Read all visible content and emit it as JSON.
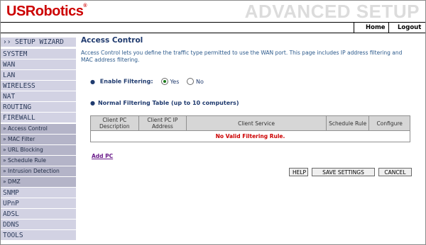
{
  "brand": {
    "logo": "USRobotics",
    "logo_mark": "®",
    "banner": "ADVANCED SETUP"
  },
  "topnav": {
    "home": "Home",
    "logout": "Logout"
  },
  "sidebar": {
    "wizard": "›› SETUP WIZARD",
    "main_items": [
      "SYSTEM",
      "WAN",
      "LAN",
      "WIRELESS",
      "NAT",
      "ROUTING",
      "FIREWALL"
    ],
    "sub_items": [
      "» Access Control",
      "» MAC Filter",
      "» URL Blocking",
      "» Schedule Rule",
      "» Intrusion Detection",
      "» DMZ"
    ],
    "more_items": [
      "SNMP",
      "UPnP",
      "ADSL",
      "DDNS",
      "TOOLS"
    ]
  },
  "page": {
    "title": "Access Control",
    "description": "Access Control lets you define the traffic type permitted to use the WAN port. This page includes IP address filtering and MAC address filtering.",
    "enable_filtering_label": "Enable Filtering:",
    "radio_yes": "Yes",
    "radio_no": "No",
    "table_title": "Normal Filtering Table (up to 10 computers)",
    "table_headers": [
      "Client PC Description",
      "Client PC IP Address",
      "Client Service",
      "Schedule Rule",
      "Configure"
    ],
    "empty_message": "No Valid Filtering Rule.",
    "add_pc": "Add PC",
    "buttons": {
      "help": "HELP",
      "save": "SAVE SETTINGS",
      "cancel": "CANCEL"
    }
  }
}
